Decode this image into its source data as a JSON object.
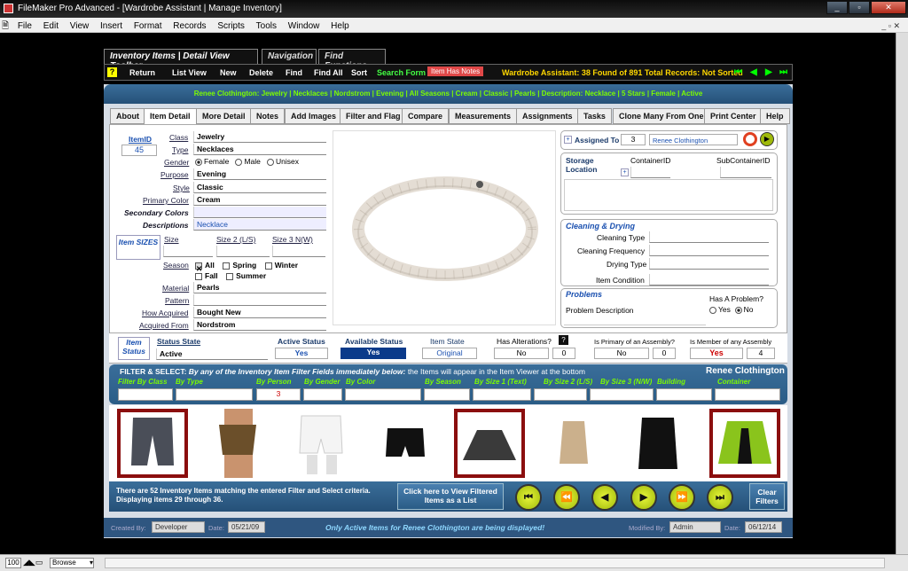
{
  "window": {
    "title": "FileMaker Pro Advanced - [Wardrobe Assistant | Manage Inventory]"
  },
  "menu": [
    "File",
    "Edit",
    "View",
    "Insert",
    "Format",
    "Records",
    "Scripts",
    "Tools",
    "Window",
    "Help"
  ],
  "toolbar_tabs": [
    "Inventory Items | Detail View Toolbar",
    "Navigation",
    "Find Functions"
  ],
  "toolbar": {
    "help": "?",
    "return": "Return",
    "list_view": "List View",
    "new": "New",
    "delete": "Delete",
    "find": "Find",
    "find_all": "Find All",
    "sort": "Sort",
    "search_form": "Search Form",
    "item_has_notes": "Item Has Notes",
    "status": "Wardrobe Assistant:  38 Found of 891 Total Records: Not Sorted"
  },
  "breadcrumb": "Renee Clothington: Jewelry | Necklaces | Nordstrom | Evening | All Seasons | Cream | Classic | Pearls | Description: Necklace | 5 Stars | Female | Active",
  "tabs": [
    "About",
    "Item Detail",
    "More Detail",
    "Notes",
    "Add Images",
    "Filter and Flag",
    "Compare",
    "Measurements",
    "Assignments",
    "Tasks",
    "Clone Many From One",
    "Print Center",
    "Help"
  ],
  "item": {
    "id_label": "ItemID",
    "id": "45",
    "class_label": "Class",
    "class": "Jewelry",
    "type_label": "Type",
    "type": "Necklaces",
    "gender_label": "Gender",
    "gender_options": [
      "Female",
      "Male",
      "Unisex"
    ],
    "purpose_label": "Purpose",
    "purpose": "Evening",
    "style_label": "Style",
    "style": "Classic",
    "primary_color_label": "Primary Color",
    "primary_color": "Cream",
    "secondary_colors_label": "Secondary Colors",
    "descriptions_label": "Descriptions",
    "descriptions": "Necklace",
    "sizes_label": "Item SIZES",
    "size_label": "Size",
    "size2_label": "Size 2 (L/S)",
    "size3_label": "Size 3 N(W)",
    "season_label": "Season",
    "seasons": [
      "All",
      "Spring",
      "Winter",
      "Fall",
      "Summer"
    ],
    "material_label": "Material",
    "material": "Pearls",
    "pattern_label": "Pattern",
    "how_acquired_label": "How Acquired",
    "how_acquired": "Bought New",
    "acquired_from_label": "Acquired From",
    "acquired_from": "Nordstrom"
  },
  "assign": {
    "assigned_to_label": "Assigned To",
    "assigned_id": "3",
    "assigned_name": "Renee Clothington",
    "storage_label": "Storage Location",
    "container_label": "ContainerID",
    "subcontainer_label": "SubContainerID"
  },
  "cleaning": {
    "title": "Cleaning & Drying",
    "type_label": "Cleaning Type",
    "freq_label": "Cleaning Frequency",
    "drying_label": "Drying Type",
    "condition_label": "Item Condition"
  },
  "problems": {
    "title": "Problems",
    "has_label": "Has A Problem?",
    "yes": "Yes",
    "no": "No",
    "desc_label": "Problem Description"
  },
  "status": {
    "section_label": "Item Status",
    "state_label": "Status State",
    "state": "Active",
    "active_label": "Active Status",
    "active": "Yes",
    "available_label": "Available Status",
    "available": "Yes",
    "item_state_label": "Item State",
    "item_state": "Original",
    "alterations_label": "Has Alterations?",
    "alterations": "No",
    "alterations_count": "0",
    "assembly_primary_label": "Is Primary of an Assembly?",
    "assembly_primary": "No",
    "assembly_primary_count": "0",
    "assembly_member_label": "Is Member of any Assembly",
    "assembly_member": "Yes",
    "assembly_member_count": "4"
  },
  "filter": {
    "title_bold": "FILTER & SELECT:",
    "title_italic": "By any of the Inventory Item Filter Fields immediately below:",
    "title_rest": " the Items will appear in the Item Viewer at the bottom",
    "owner": "Renee Clothington",
    "fields": [
      "Filter By Class",
      "By Type",
      "By Person",
      "By Gender",
      "By Color",
      "By Season",
      "By Size 1 (Text)",
      "By Size 2 (L/S)",
      "By Size 3 (N/W)",
      "Building",
      "Container"
    ],
    "person_value": "3"
  },
  "bottom": {
    "message": "There are 52 Inventory Items matching the entered Filter and Select criteria. Displaying items 29 through 36.",
    "view_list": "Click here to View Filtered Items as a List",
    "clear": "Clear Filters"
  },
  "footer": {
    "created_by_label": "Created By:",
    "created_by": "Developer",
    "date_label": "Date:",
    "created_date": "05/21/09",
    "notice": "Only Active Items for Renee Clothington are being displayed!",
    "modified_by_label": "Modified By:",
    "modified_by": "Admin",
    "modified_date": "06/12/14"
  },
  "statusbar": {
    "zoom": "100",
    "mode": "Browse"
  },
  "colors": {
    "accent_green": "#7cfc00",
    "panel_blue": "#2a5c86",
    "highlight_red": "#8b0e0e",
    "yellow_btn": "#d8ea2a"
  }
}
